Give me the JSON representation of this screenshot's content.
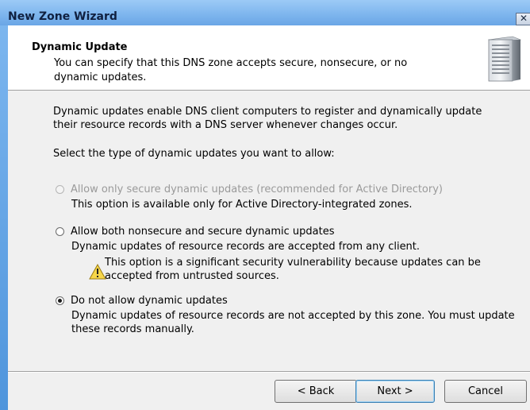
{
  "window": {
    "title": "New Zone Wizard",
    "close_glyph": "✕"
  },
  "header": {
    "title": "Dynamic Update",
    "description": "You can specify that this DNS zone accepts secure, nonsecure, or no dynamic updates.",
    "icon": "server-icon"
  },
  "body": {
    "intro": "Dynamic updates enable DNS client computers to register and dynamically update their resource records with a DNS server whenever changes occur.",
    "prompt": "Select the type of dynamic updates you want to allow:"
  },
  "options": [
    {
      "label": "Allow only secure dynamic updates (recommended for Active Directory)",
      "note": "This option is available only for Active Directory-integrated zones.",
      "selected": false,
      "enabled": false
    },
    {
      "label": "Allow both nonsecure and secure dynamic updates",
      "note": "Dynamic updates of resource records are accepted from any client.",
      "warning": "This option is a significant security vulnerability because updates can be accepted from untrusted sources.",
      "selected": false,
      "enabled": true
    },
    {
      "label": "Do not allow dynamic updates",
      "note": "Dynamic updates of resource records are not accepted by this zone. You must update these records manually.",
      "selected": true,
      "enabled": true
    }
  ],
  "buttons": {
    "back": "< Back",
    "next": "Next >",
    "cancel": "Cancel"
  },
  "colors": {
    "titlebar": "#7fb6ee",
    "dialog_bg": "#f0f0f0",
    "header_bg": "#ffffff"
  }
}
